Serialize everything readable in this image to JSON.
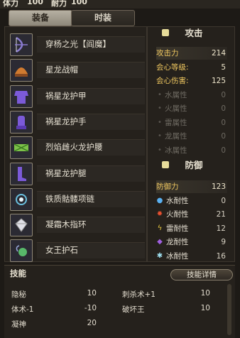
{
  "topbar": {
    "stamina_label": "体力",
    "stamina_value": "100",
    "endurance_label": "耐力",
    "endurance_value": "100"
  },
  "tabs": {
    "equipment": "装备",
    "fashion": "时装"
  },
  "equipment": [
    {
      "name": "穿杨之光【阎魔】",
      "icon": "bow-icon",
      "color": "#8a7bd0"
    },
    {
      "name": "星龙战帽",
      "icon": "helmet-icon",
      "color": "#d07a30"
    },
    {
      "name": "祸星龙护甲",
      "icon": "armor-icon",
      "color": "#7b5ad8"
    },
    {
      "name": "祸星龙护手",
      "icon": "gauntlet-icon",
      "color": "#7b5ad8"
    },
    {
      "name": "烈焰雌火龙护腰",
      "icon": "waist-icon",
      "color": "#7dc24a"
    },
    {
      "name": "祸星龙护腿",
      "icon": "greaves-icon",
      "color": "#7b5ad8"
    },
    {
      "name": "铁质骷髅项链",
      "icon": "necklace-icon",
      "color": "#6ac0e0"
    },
    {
      "name": "凝霜木指环",
      "icon": "ring-icon",
      "color": "#e0e0e8"
    },
    {
      "name": "女王护石",
      "icon": "amulet-icon",
      "color": "#58b86a"
    }
  ],
  "attack": {
    "title": "攻击",
    "stats": [
      {
        "label": "攻击力",
        "value": "214"
      },
      {
        "label": "会心等级:",
        "value": "5"
      },
      {
        "label": "会心伤害:",
        "value": "125"
      },
      {
        "label": "水属性",
        "value": "0"
      },
      {
        "label": "火属性",
        "value": "0"
      },
      {
        "label": "雷属性",
        "value": "0"
      },
      {
        "label": "龙属性",
        "value": "0"
      },
      {
        "label": "冰属性",
        "value": "0"
      }
    ]
  },
  "defense": {
    "title": "防御",
    "stats": [
      {
        "label": "防御力",
        "value": "123"
      },
      {
        "label": "水耐性",
        "value": "0",
        "icon": "water-icon",
        "color": "#5ab0f0"
      },
      {
        "label": "火耐性",
        "value": "21",
        "icon": "fire-icon",
        "color": "#e85030"
      },
      {
        "label": "雷耐性",
        "value": "12",
        "icon": "thunder-icon",
        "color": "#f0d040"
      },
      {
        "label": "龙耐性",
        "value": "9",
        "icon": "dragon-icon",
        "color": "#a060e0"
      },
      {
        "label": "冰耐性",
        "value": "16",
        "icon": "ice-icon",
        "color": "#a0e0f0"
      }
    ]
  },
  "skills": {
    "title": "技能",
    "details_button": "技能详情",
    "list": [
      {
        "name": "隐秘",
        "value": "10"
      },
      {
        "name": "刺杀术+1",
        "value": "10"
      },
      {
        "name": "体术-1",
        "value": "-10"
      },
      {
        "name": "破坏王",
        "value": "10"
      },
      {
        "name": "凝神",
        "value": "20"
      }
    ]
  }
}
